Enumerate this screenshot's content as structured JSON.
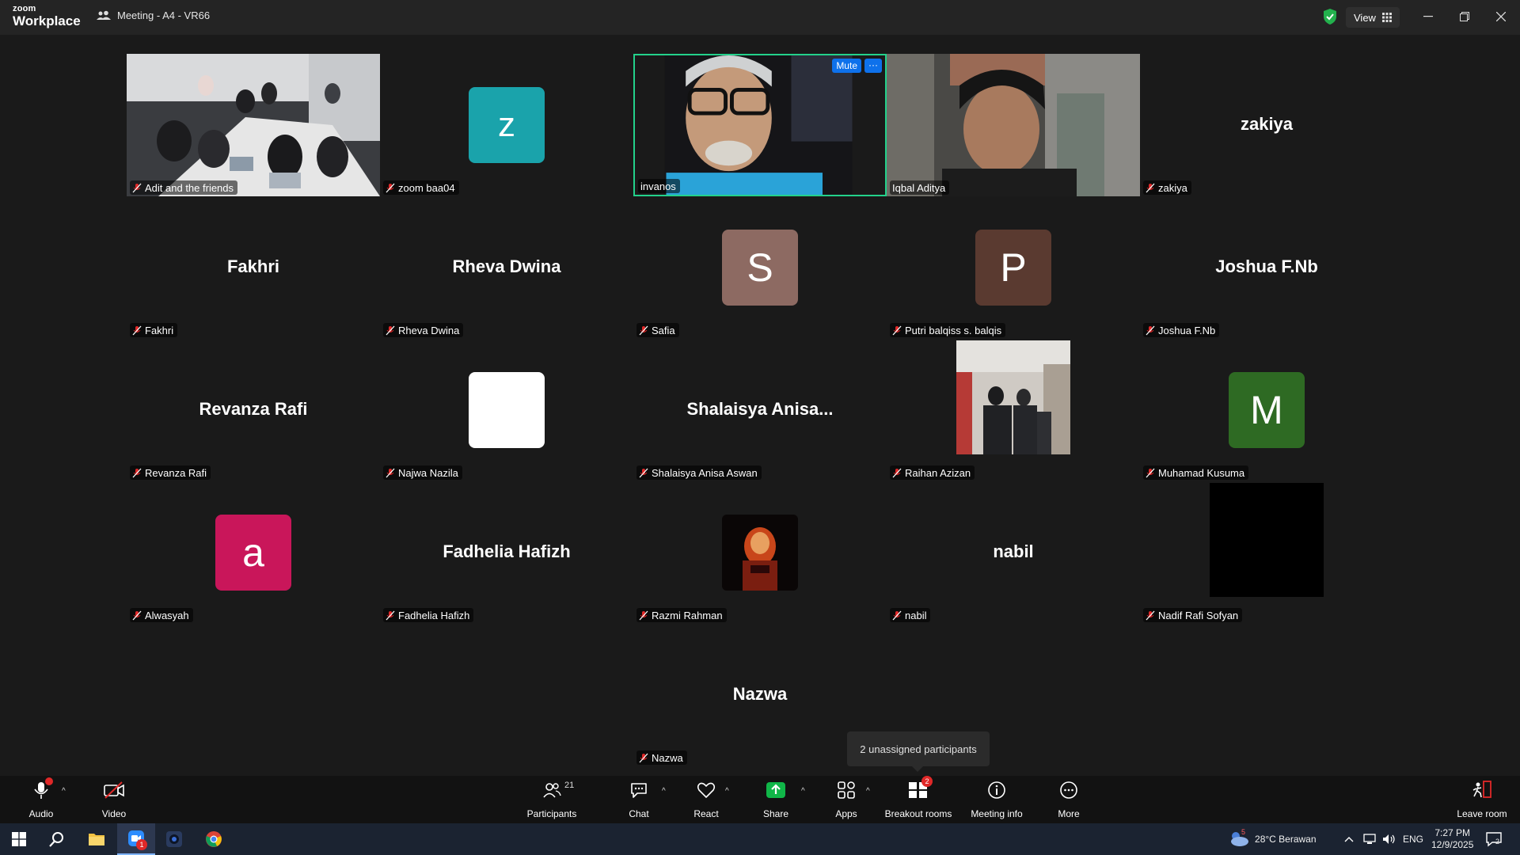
{
  "window": {
    "logo_line1": "zoom",
    "logo_line2": "Workplace",
    "meeting_title": "Meeting - A4 - VR66",
    "view_label": "View"
  },
  "tiles": {
    "r1c1": {
      "name": "Adit and the friends"
    },
    "r1c2": {
      "name": "zoom baa04",
      "initial": "z"
    },
    "r1c3": {
      "name": "invanos",
      "mute_label": "Mute",
      "more_label": "···"
    },
    "r1c4": {
      "name": "Iqbal Aditya"
    },
    "r1c5": {
      "name": "zakiya",
      "display": "zakiya"
    },
    "r2c1": {
      "name": "Fakhri",
      "display": "Fakhri"
    },
    "r2c2": {
      "name": "Rheva Dwina",
      "display": "Rheva Dwina"
    },
    "r2c3": {
      "name": "Safia",
      "initial": "S"
    },
    "r2c4": {
      "name": "Putri balqiss s. balqis",
      "initial": "P"
    },
    "r2c5": {
      "name": "Joshua F.Nb",
      "display": "Joshua F.Nb"
    },
    "r3c1": {
      "name": "Revanza Rafi",
      "display": "Revanza Rafi"
    },
    "r3c2": {
      "name": "Najwa Nazila"
    },
    "r3c3": {
      "name": "Shalaisya Anisa Aswan",
      "display": "Shalaisya  Anisa..."
    },
    "r3c4": {
      "name": "Raihan Azizan"
    },
    "r3c5": {
      "name": "Muhamad Kusuma",
      "initial": "M"
    },
    "r4c1": {
      "name": "Alwasyah",
      "initial": "a"
    },
    "r4c2": {
      "name": "Fadhelia Hafizh",
      "display": "Fadhelia Hafizh"
    },
    "r4c3": {
      "name": "Razmi Rahman"
    },
    "r4c4": {
      "name": "nabil",
      "display": "nabil"
    },
    "r4c5": {
      "name": "Nadif Rafi Sofyan"
    },
    "r5c3": {
      "name": "Nazwa",
      "display": "Nazwa"
    }
  },
  "tooltip": "2 unassigned participants",
  "toolbar": {
    "audio": "Audio",
    "video": "Video",
    "participants": "Participants",
    "participants_count": "21",
    "chat": "Chat",
    "react": "React",
    "share": "Share",
    "apps": "Apps",
    "breakout": "Breakout rooms",
    "breakout_badge": "2",
    "meeting_info": "Meeting info",
    "more": "More",
    "leave": "Leave room"
  },
  "taskbar": {
    "zoom_badge": "1",
    "weather_badge": "5",
    "weather": "28°C  Berawan",
    "lang": "ENG",
    "time": "7:27 PM",
    "date": "12/9/2025",
    "notif_count": "2"
  },
  "colors": {
    "active_speaker": "#23d18b",
    "zoom_blue": "#0e71eb",
    "share_green": "#10b648",
    "mute_red": "#e02828"
  }
}
